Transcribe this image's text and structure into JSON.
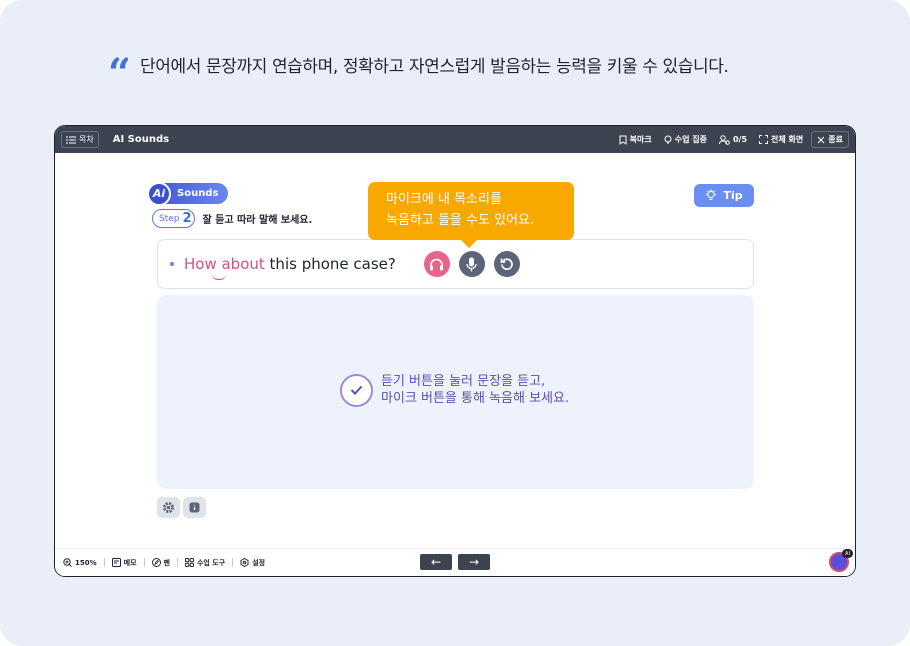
{
  "caption": {
    "quote_mark": "“",
    "text": "단어에서 문장까지 연습하며, 정확하고 자연스럽게 발음하는 능력을 키울 수 있습니다."
  },
  "topbar": {
    "menu_label": "목차",
    "title": "AI Sounds",
    "bookmark_label": "북마크",
    "focus_label": "수업 집중",
    "users_count": "0/5",
    "fullscreen_label": "전체 화면",
    "close_label": "종료"
  },
  "badge": {
    "ai": "Ai",
    "label": "Sounds"
  },
  "step": {
    "label": "Step",
    "number": "2",
    "instruction": "잘 듣고 따라 말해 보세요."
  },
  "tip_label": "Tip",
  "tooltip": {
    "line1": "마이크에 내 목소리를",
    "line2": "녹음하고 들을 수도 있어요."
  },
  "sentence": {
    "highlight": "How about",
    "rest": " this phone case?"
  },
  "record_area": {
    "line1": "듣기 버튼을 눌러 문장을 듣고,",
    "line2": "마이크 버튼을 통해 녹음해 보세요."
  },
  "bottombar": {
    "zoom": "150%",
    "memo_label": "메모",
    "pen_label": "펜",
    "tools_label": "수업 도구",
    "settings_label": "설정",
    "prev_arrow": "←",
    "next_arrow": "→",
    "ai_badge": "AI"
  },
  "icons": [
    "list-icon",
    "bookmark-icon",
    "bulb-icon",
    "users-icon",
    "fullscreen-icon",
    "close-icon",
    "headphones-icon",
    "mic-icon",
    "reset-icon",
    "check-icon",
    "gear-icon",
    "info-icon",
    "zoom-icon",
    "memo-icon",
    "pen-icon",
    "tools-icon",
    "settings-icon"
  ],
  "colors": {
    "accent": "#3d6fe0",
    "highlight": "#d94f88",
    "tooltip": "#f9a800",
    "listen": "#e7648a",
    "dark": "#3d4350"
  }
}
